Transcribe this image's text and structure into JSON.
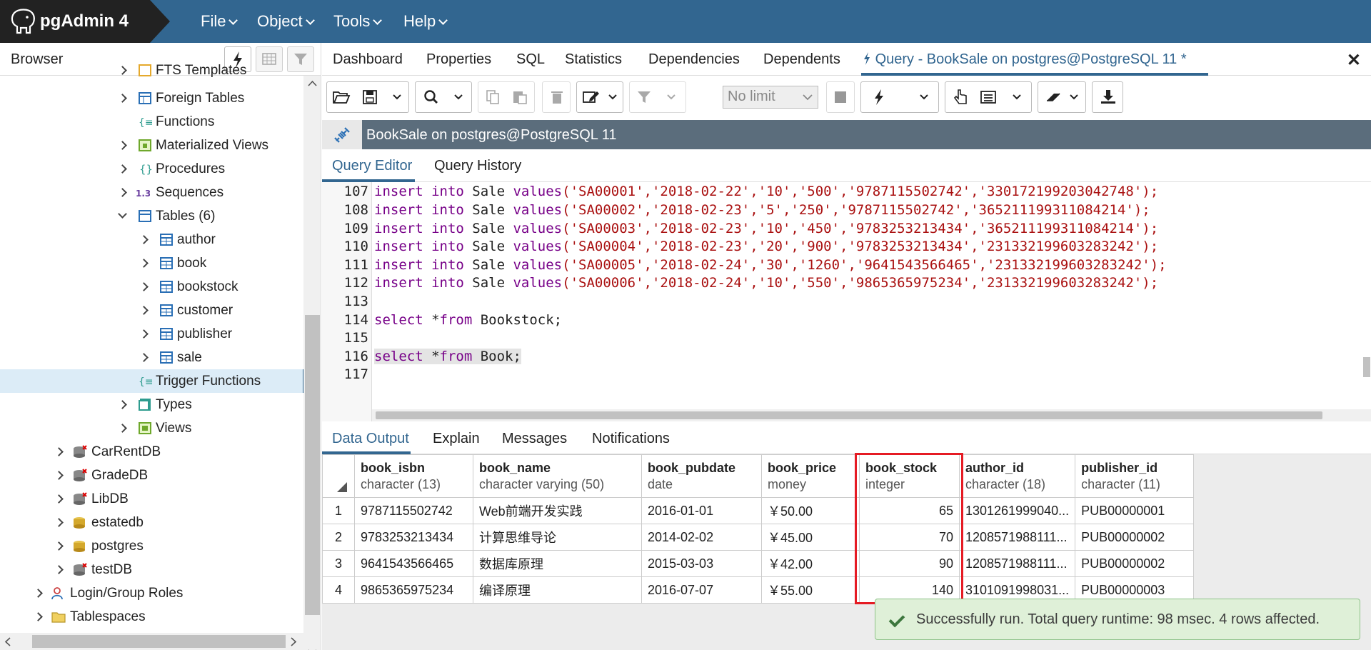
{
  "app": {
    "title": "pgAdmin 4"
  },
  "menu": [
    {
      "label": "File"
    },
    {
      "label": "Object"
    },
    {
      "label": "Tools"
    },
    {
      "label": "Help"
    }
  ],
  "browser": {
    "title": "Browser",
    "tree": [
      {
        "label": "FTS Templates",
        "icon": "fts-templates-icon"
      },
      {
        "label": "Foreign Tables",
        "icon": "foreign-table-icon"
      },
      {
        "label": "Functions",
        "icon": "function-icon"
      },
      {
        "label": "Materialized Views",
        "icon": "materialized-view-icon"
      },
      {
        "label": "Procedures",
        "icon": "procedure-icon"
      },
      {
        "label": "Sequences",
        "icon": "sequence-icon"
      },
      {
        "label": "Tables (6)",
        "icon": "tables-icon"
      },
      {
        "label": "author",
        "icon": "table-icon"
      },
      {
        "label": "book",
        "icon": "table-icon"
      },
      {
        "label": "bookstock",
        "icon": "table-icon"
      },
      {
        "label": "customer",
        "icon": "table-icon"
      },
      {
        "label": "publisher",
        "icon": "table-icon"
      },
      {
        "label": "sale",
        "icon": "table-icon"
      },
      {
        "label": "Trigger Functions",
        "icon": "trigger-function-icon"
      },
      {
        "label": "Types",
        "icon": "type-icon"
      },
      {
        "label": "Views",
        "icon": "view-icon"
      },
      {
        "label": "CarRentDB",
        "icon": "database-disconnected-icon"
      },
      {
        "label": "GradeDB",
        "icon": "database-disconnected-icon"
      },
      {
        "label": "LibDB",
        "icon": "database-disconnected-icon"
      },
      {
        "label": "estatedb",
        "icon": "database-icon"
      },
      {
        "label": "postgres",
        "icon": "database-icon"
      },
      {
        "label": "testDB",
        "icon": "database-disconnected-icon"
      },
      {
        "label": "Login/Group Roles",
        "icon": "roles-icon"
      },
      {
        "label": "Tablespaces",
        "icon": "tablespaces-icon"
      }
    ]
  },
  "tabs": [
    {
      "label": "Dashboard"
    },
    {
      "label": "Properties"
    },
    {
      "label": "SQL"
    },
    {
      "label": "Statistics"
    },
    {
      "label": "Dependencies"
    },
    {
      "label": "Dependents"
    },
    {
      "label": "Query - BookSale on postgres@PostgreSQL 11 *"
    }
  ],
  "toolbar": {
    "limit": "No limit"
  },
  "connection": {
    "label": "BookSale on postgres@PostgreSQL 11"
  },
  "editor_tabs": [
    {
      "label": "Query Editor"
    },
    {
      "label": "Query History"
    }
  ],
  "editor": {
    "lines": [
      {
        "n": "107",
        "kw1": "insert into",
        "mid": " Sale ",
        "kw2": "values",
        "args": "('SA00001','2018-02-22','10','500','9787115502742','330172199203042748');"
      },
      {
        "n": "108",
        "kw1": "insert into",
        "mid": " Sale ",
        "kw2": "values",
        "args": "('SA00002','2018-02-23','5','250','9787115502742','365211199311084214');"
      },
      {
        "n": "109",
        "kw1": "insert into",
        "mid": " Sale ",
        "kw2": "values",
        "args": "('SA00003','2018-02-23','10','450','9783253213434','365211199311084214');"
      },
      {
        "n": "110",
        "kw1": "insert into",
        "mid": " Sale ",
        "kw2": "values",
        "args": "('SA00004','2018-02-23','20','900','9783253213434','231332199603283242');"
      },
      {
        "n": "111",
        "kw1": "insert into",
        "mid": " Sale ",
        "kw2": "values",
        "args": "('SA00005','2018-02-24','30','1260','9641543566465','231332199603283242');"
      },
      {
        "n": "112",
        "kw1": "insert into",
        "mid": " Sale ",
        "kw2": "values",
        "args": "('SA00006','2018-02-24','10','550','9865365975234','231332199603283242');"
      },
      {
        "n": "113"
      },
      {
        "n": "114",
        "kw1": "select",
        "mid": " *",
        "kw2": "from",
        "args": " Bookstock;"
      },
      {
        "n": "115"
      },
      {
        "n": "116",
        "kw1": "select",
        "mid": " *",
        "kw2": "from",
        "args": " Book;"
      },
      {
        "n": "117"
      }
    ]
  },
  "output_tabs": [
    {
      "label": "Data Output"
    },
    {
      "label": "Explain"
    },
    {
      "label": "Messages"
    },
    {
      "label": "Notifications"
    }
  ],
  "grid": {
    "columns": [
      {
        "name": "book_isbn",
        "type": "character (13)"
      },
      {
        "name": "book_name",
        "type": "character varying (50)"
      },
      {
        "name": "book_pubdate",
        "type": "date"
      },
      {
        "name": "book_price",
        "type": "money"
      },
      {
        "name": "book_stock",
        "type": "integer"
      },
      {
        "name": "author_id",
        "type": "character (18)"
      },
      {
        "name": "publisher_id",
        "type": "character (11)"
      }
    ],
    "rows": [
      [
        "1",
        "9787115502742",
        "Web前端开发实践",
        "2016-01-01",
        "￥50.00",
        "65",
        "1301261999040...",
        "PUB00000001"
      ],
      [
        "2",
        "9783253213434",
        "计算思维导论",
        "2014-02-02",
        "￥45.00",
        "70",
        "1208571988111...",
        "PUB00000002"
      ],
      [
        "3",
        "9641543566465",
        "数据库原理",
        "2015-03-03",
        "￥42.00",
        "90",
        "1208571988111...",
        "PUB00000002"
      ],
      [
        "4",
        "9865365975234",
        "编译原理",
        "2016-07-07",
        "￥55.00",
        "140",
        "3101091998031...",
        "PUB00000003"
      ]
    ]
  },
  "toast": {
    "message": "Successfully run. Total query runtime: 98 msec. 4 rows affected."
  },
  "colors": {
    "brand": "#326690",
    "highlight": "#e51b24",
    "success": "#dff0d8"
  }
}
